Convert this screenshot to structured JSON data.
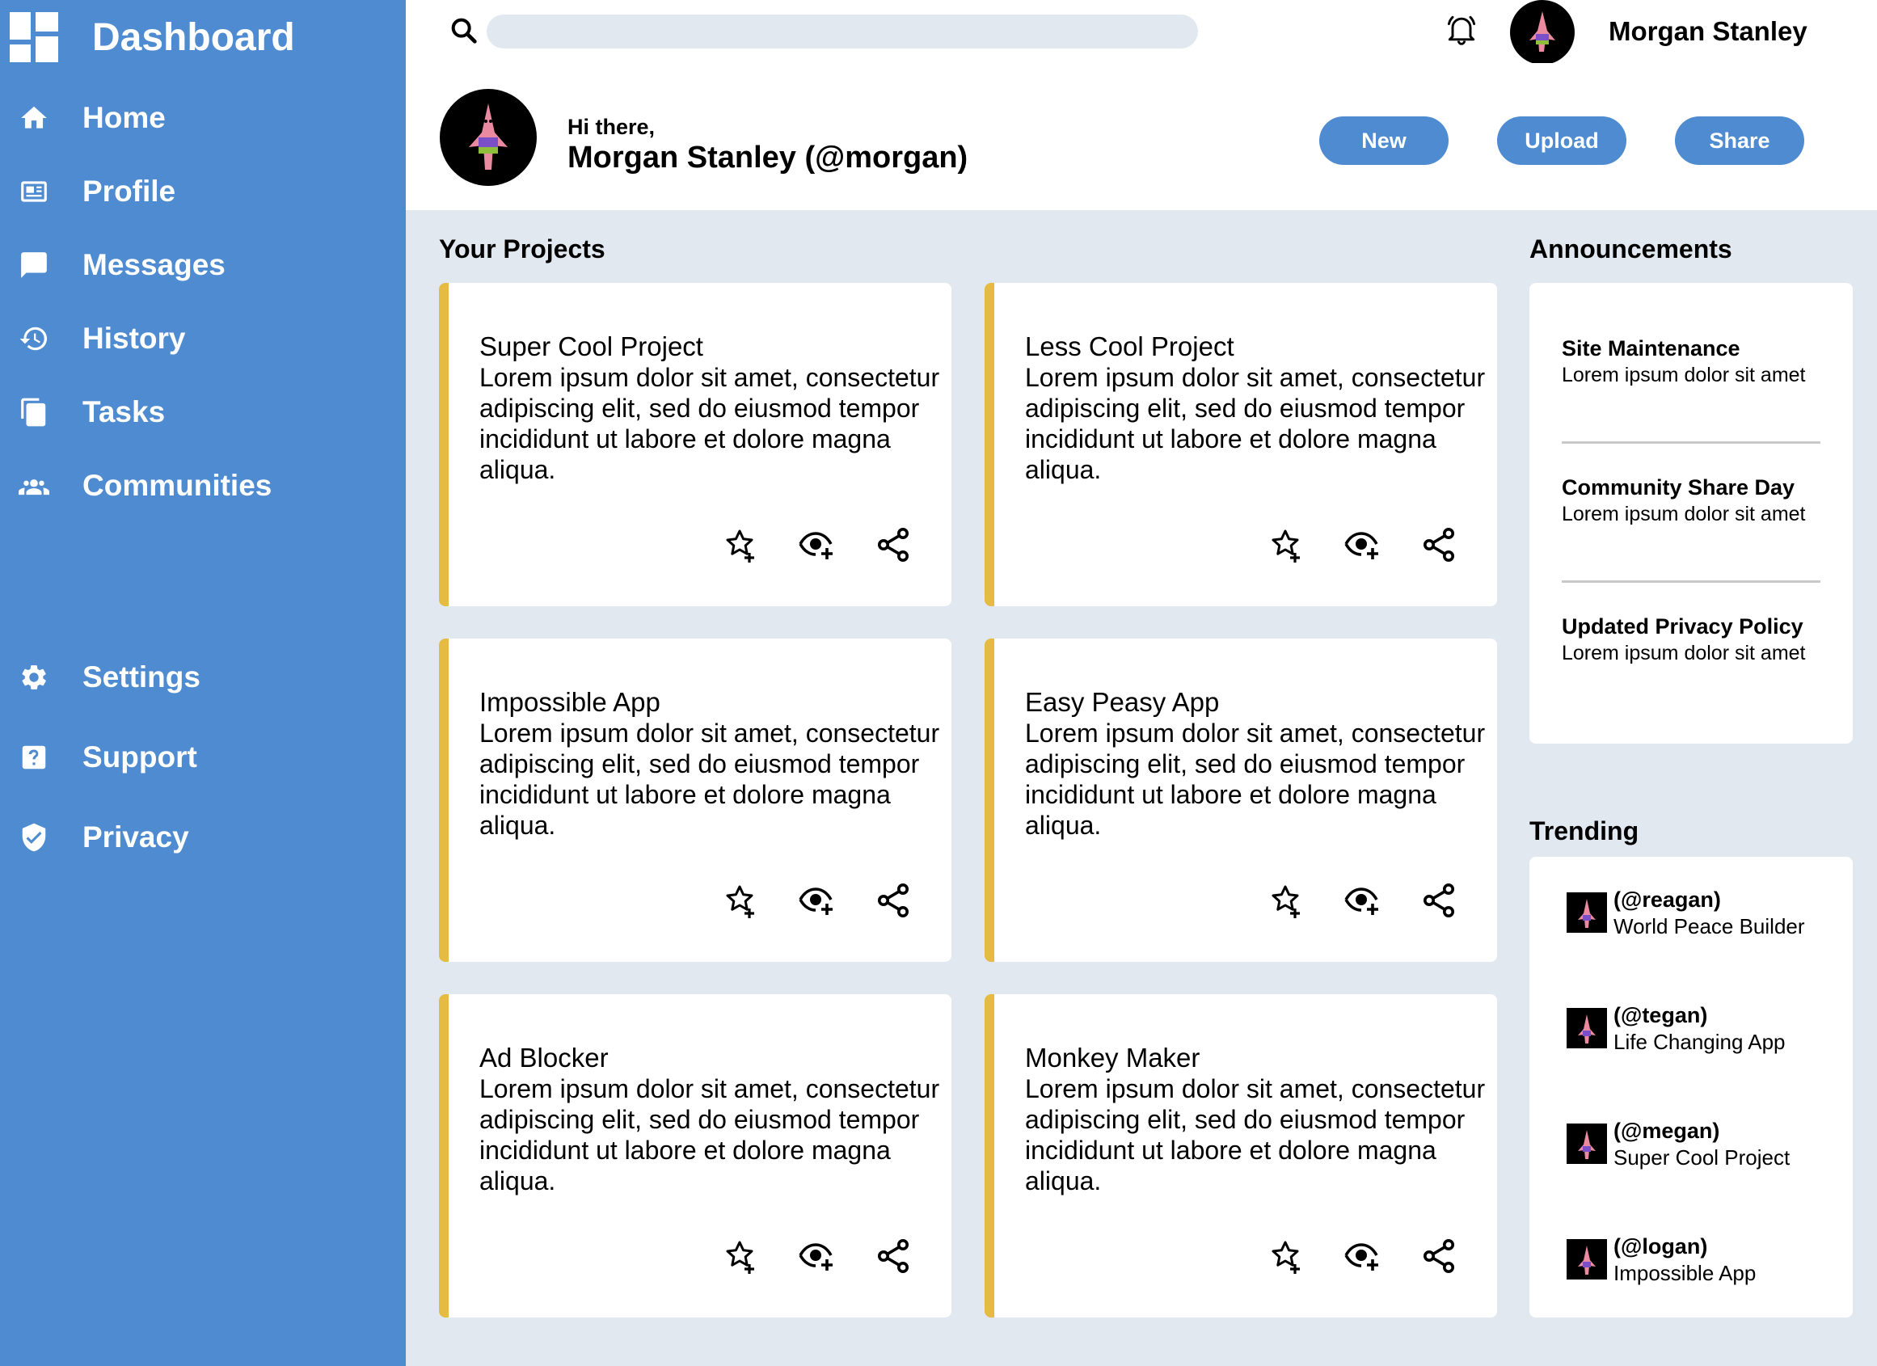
{
  "app": {
    "title": "Dashboard"
  },
  "sidebar": {
    "items": [
      {
        "label": "Home",
        "icon": "home-icon"
      },
      {
        "label": "Profile",
        "icon": "profile-card-icon"
      },
      {
        "label": "Messages",
        "icon": "message-icon"
      },
      {
        "label": "History",
        "icon": "history-icon"
      },
      {
        "label": "Tasks",
        "icon": "tasks-icon"
      },
      {
        "label": "Communities",
        "icon": "communities-icon"
      },
      {
        "label": "Settings",
        "icon": "gear-icon"
      },
      {
        "label": "Support",
        "icon": "help-icon"
      },
      {
        "label": "Privacy",
        "icon": "shield-icon"
      }
    ]
  },
  "topbar": {
    "search": {
      "placeholder": "",
      "value": ""
    },
    "username": "Morgan Stanley"
  },
  "header": {
    "greeting": "Hi there,",
    "name": "Morgan Stanley (@morgan)",
    "buttons": {
      "new": "New",
      "upload": "Upload",
      "share": "Share"
    }
  },
  "projects": {
    "heading": "Your Projects",
    "items": [
      {
        "title": "Super Cool Project",
        "description": "Lorem ipsum dolor sit amet, consectetur adipiscing elit, sed do eiusmod tempor incididunt ut labore et dolore magna aliqua."
      },
      {
        "title": "Less Cool Project",
        "description": "Lorem ipsum dolor sit amet, consectetur adipiscing elit, sed do eiusmod tempor incididunt ut labore et dolore magna aliqua."
      },
      {
        "title": "Impossible App",
        "description": "Lorem ipsum dolor sit amet, consectetur adipiscing elit, sed do eiusmod tempor incididunt ut labore et dolore magna aliqua."
      },
      {
        "title": "Easy Peasy App",
        "description": "Lorem ipsum dolor sit amet, consectetur adipiscing elit, sed do eiusmod tempor incididunt ut labore et dolore magna aliqua."
      },
      {
        "title": "Ad Blocker",
        "description": "Lorem ipsum dolor sit amet, consectetur adipiscing elit, sed do eiusmod tempor incididunt ut labore et dolore magna aliqua."
      },
      {
        "title": "Monkey Maker",
        "description": "Lorem ipsum dolor sit amet, consectetur adipiscing elit, sed do eiusmod tempor incididunt ut labore et dolore magna aliqua."
      }
    ]
  },
  "announcements": {
    "heading": "Announcements",
    "items": [
      {
        "title": "Site Maintenance",
        "text": "Lorem ipsum dolor sit amet"
      },
      {
        "title": "Community Share Day",
        "text": "Lorem ipsum dolor sit amet"
      },
      {
        "title": "Updated Privacy Policy",
        "text": "Lorem ipsum dolor sit amet"
      }
    ]
  },
  "trending": {
    "heading": "Trending",
    "items": [
      {
        "handle": "(@reagan)",
        "project": "World Peace Builder"
      },
      {
        "handle": "(@tegan)",
        "project": "Life Changing App"
      },
      {
        "handle": "(@megan)",
        "project": "Super Cool Project"
      },
      {
        "handle": "(@logan)",
        "project": "Impossible App"
      }
    ]
  },
  "colors": {
    "sidebar": "#4e8bd0",
    "accent": "#e6bb42",
    "background": "#e2e8f0"
  }
}
